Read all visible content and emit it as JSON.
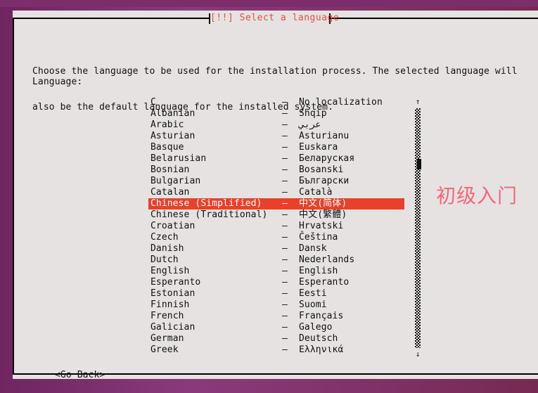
{
  "desktop": {
    "background_color": "#772953"
  },
  "dialog": {
    "title": "[!!] Select a language",
    "title_color": "#e0503d",
    "background_color": "#e6e2e2",
    "intro_line1": "Choose the language to be used for the installation process. The selected language will",
    "intro_line2": "also be the default language for the installed system.",
    "field_label": "Language:",
    "go_back_label": "<Go Back>"
  },
  "language_list": {
    "selected_index": 9,
    "selection_color": "#e8402a",
    "separator": "–",
    "items": [
      {
        "english": "C",
        "native": "No localization"
      },
      {
        "english": "Albanian",
        "native": "Shqip"
      },
      {
        "english": "Arabic",
        "native": "عربي"
      },
      {
        "english": "Asturian",
        "native": "Asturianu"
      },
      {
        "english": "Basque",
        "native": "Euskara"
      },
      {
        "english": "Belarusian",
        "native": "Беларуская"
      },
      {
        "english": "Bosnian",
        "native": "Bosanski"
      },
      {
        "english": "Bulgarian",
        "native": "Български"
      },
      {
        "english": "Catalan",
        "native": "Català"
      },
      {
        "english": "Chinese (Simplified)",
        "native": "中文(简体)"
      },
      {
        "english": "Chinese (Traditional)",
        "native": "中文(繁體)"
      },
      {
        "english": "Croatian",
        "native": "Hrvatski"
      },
      {
        "english": "Czech",
        "native": "Čeština"
      },
      {
        "english": "Danish",
        "native": "Dansk"
      },
      {
        "english": "Dutch",
        "native": "Nederlands"
      },
      {
        "english": "English",
        "native": "English"
      },
      {
        "english": "Esperanto",
        "native": "Esperanto"
      },
      {
        "english": "Estonian",
        "native": "Eesti"
      },
      {
        "english": "Finnish",
        "native": "Suomi"
      },
      {
        "english": "French",
        "native": "Français"
      },
      {
        "english": "Galician",
        "native": "Galego"
      },
      {
        "english": "German",
        "native": "Deutsch"
      },
      {
        "english": "Greek",
        "native": "Ελληνικά"
      }
    ]
  },
  "scrollbar": {
    "up_arrow": "↑",
    "down_arrow": "↓"
  },
  "watermark": {
    "text": "初级入门",
    "color": "#f2687a"
  }
}
